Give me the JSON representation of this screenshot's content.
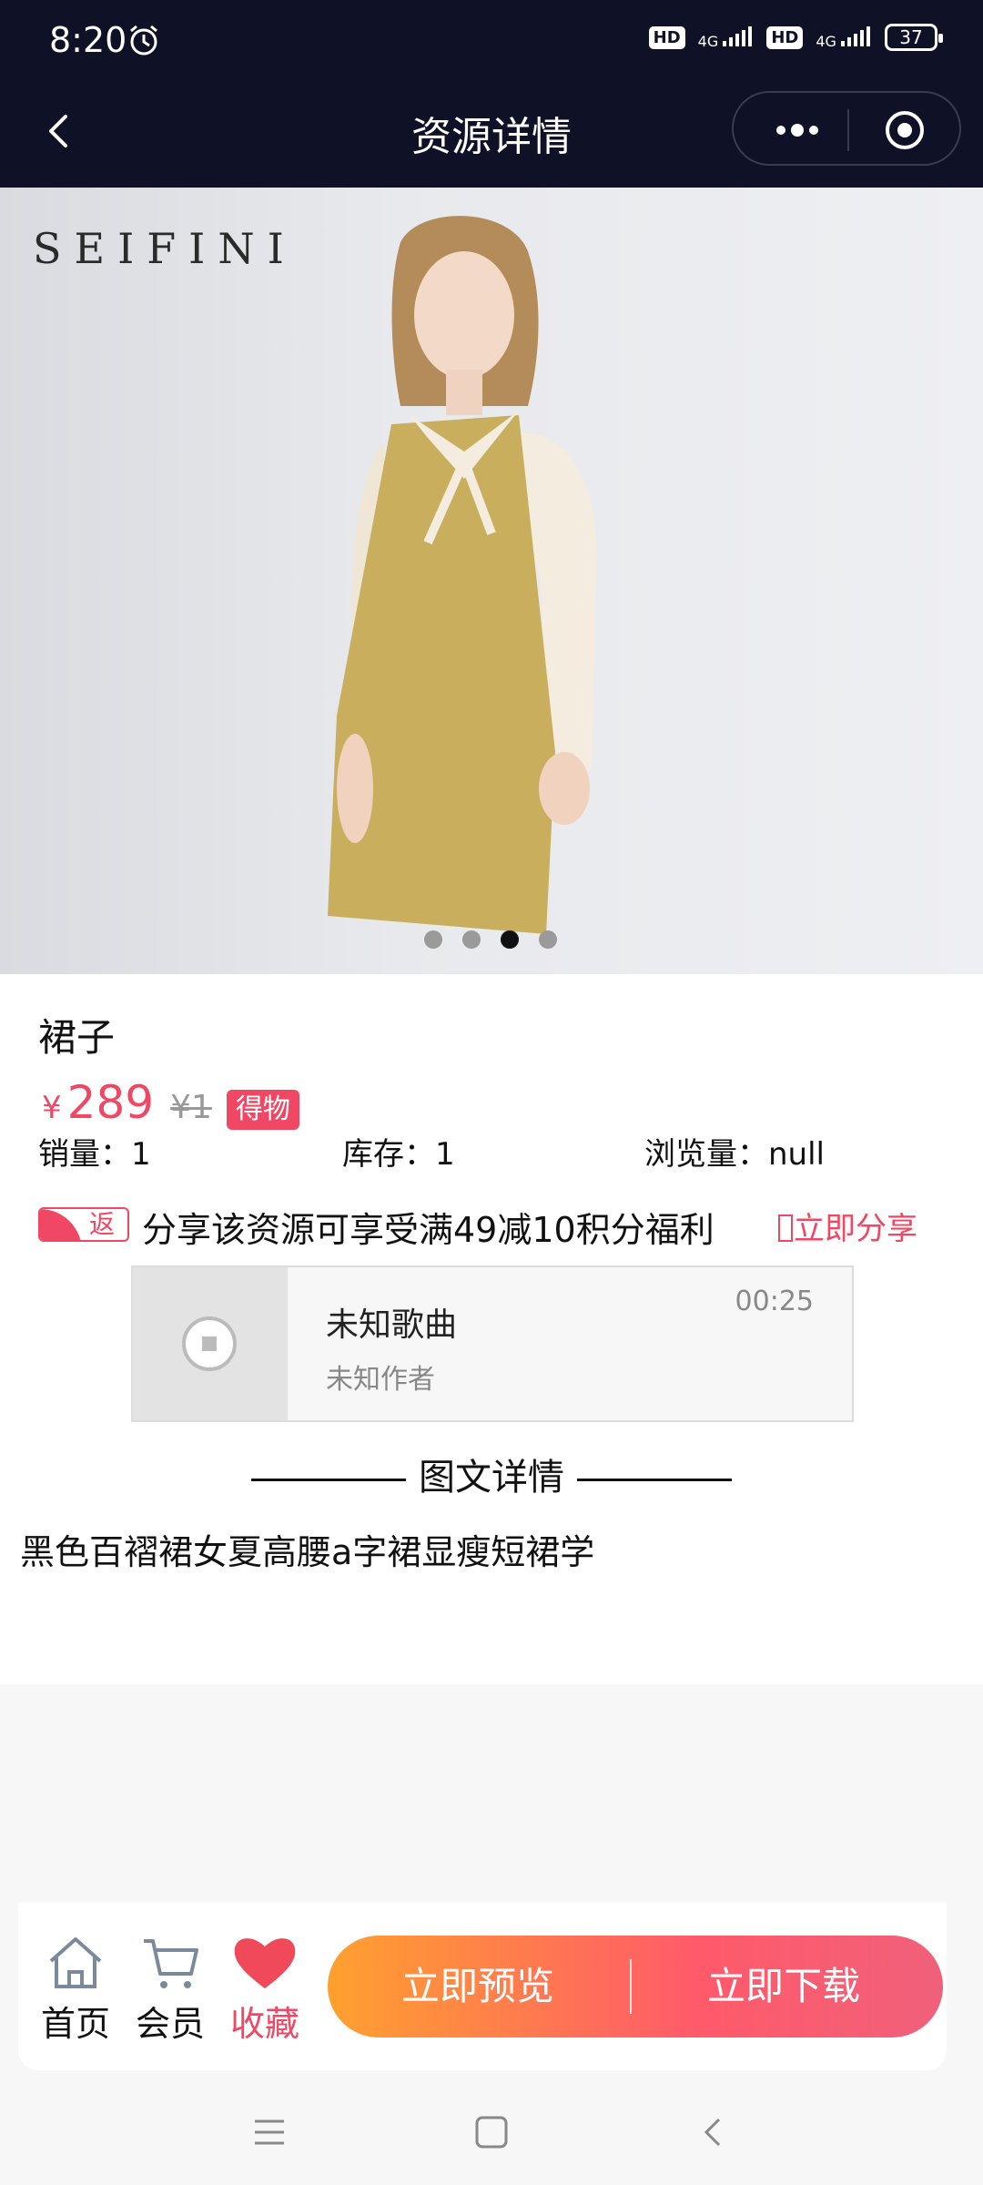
{
  "status_bar": {
    "time": "8:20",
    "hd1": "HD",
    "net1": "4G",
    "hd2": "HD",
    "net2": "4G",
    "battery": "37"
  },
  "header": {
    "title": "资源详情"
  },
  "banner": {
    "brand": "SEIFINI",
    "pages": 4,
    "active_page": 3
  },
  "product": {
    "name": "裙子",
    "price_symbol": "¥",
    "price": "289",
    "original_price": "¥1",
    "tag": "得物",
    "sales": "销量：1",
    "stock": "库存：1",
    "views": "浏览量：null"
  },
  "share": {
    "badge": "返",
    "text": "分享该资源可享受满49减10积分福利",
    "button": "立即分享"
  },
  "audio": {
    "title": "未知歌曲",
    "artist": "未知作者",
    "duration": "00:25"
  },
  "detail": {
    "section_title": "图文详情",
    "description": "黑色百褶裙女夏高腰a字裙显瘦短裙学"
  },
  "bottom_bar": {
    "home": "首页",
    "member": "会员",
    "favorite": "收藏",
    "preview": "立即预览",
    "download": "立即下载"
  },
  "colors": {
    "header_bg": "#0f1126",
    "accent": "#f04864",
    "gradient_start": "#ffa02f",
    "gradient_end": "#f0607a"
  }
}
